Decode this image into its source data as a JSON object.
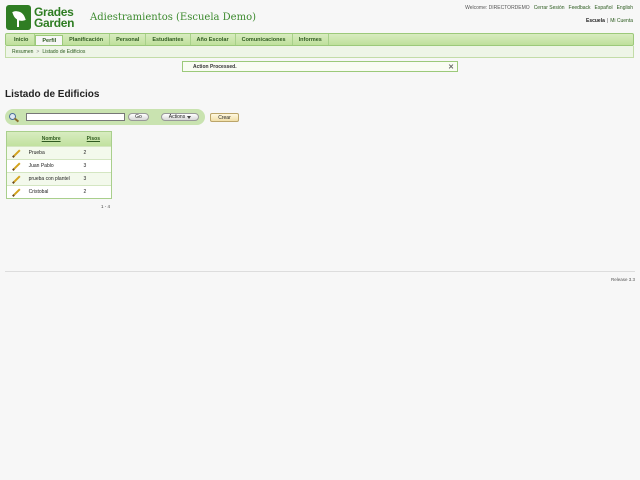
{
  "header": {
    "logo_line1": "Grades",
    "logo_line2": "Garden",
    "school_name": "Adiestramientos (Escuela Demo)",
    "welcome_label": "Welcome:",
    "user": "DIRECTORDEMO",
    "logout": "Cerrar Sesión",
    "feedback": "Feedback",
    "lang_es": "Español",
    "lang_en": "English",
    "context_school": "Escuela",
    "context_sep": "|",
    "my_account": "Mi Cuenta"
  },
  "nav": {
    "items": [
      {
        "label": "Inicio"
      },
      {
        "label": "Perfil"
      },
      {
        "label": "Planificación"
      },
      {
        "label": "Personal"
      },
      {
        "label": "Estudiantes"
      },
      {
        "label": "Año Escolar"
      },
      {
        "label": "Comunicaciones"
      },
      {
        "label": "Informes"
      }
    ],
    "active": "Perfil"
  },
  "breadcrumb": {
    "root": "Resumen",
    "separator": ">",
    "current": "Listado de Edificios"
  },
  "message": {
    "text": "Action Processed.",
    "close": "✕"
  },
  "page": {
    "title": "Listado de Edificios"
  },
  "search": {
    "placeholder": "",
    "go": "Go",
    "actions": "Actions",
    "create": "Crear"
  },
  "table": {
    "headers": {
      "name": "Nombre",
      "floors": "Pisos"
    },
    "rows": [
      {
        "name": "Prueba",
        "floors": "2"
      },
      {
        "name": "Juan Pablo",
        "floors": "3"
      },
      {
        "name": "prueba con plantel",
        "floors": "3"
      },
      {
        "name": "Cristobal",
        "floors": "2"
      }
    ],
    "pager": "1 - 4"
  },
  "footer": {
    "release": "Release 3.3"
  },
  "colors": {
    "brand_green": "#2f7d23",
    "nav_bg": "#c9e3b0",
    "link": "#2a5a1d"
  },
  "icons": {
    "search": "search-icon",
    "edit": "pencil-icon",
    "close": "close-icon",
    "dropdown": "chevron-down-icon"
  }
}
